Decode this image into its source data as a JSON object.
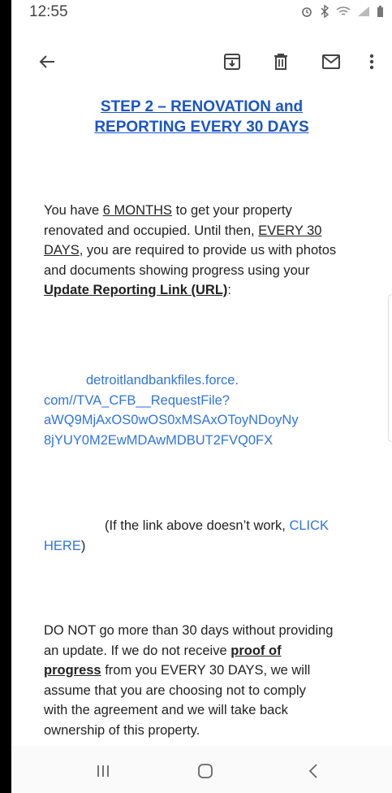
{
  "status_bar": {
    "time": "12:55"
  },
  "toolbar": {
    "back_icon": "arrow-left-icon",
    "archive_icon": "archive-icon",
    "delete_icon": "trash-icon",
    "mail_icon": "mail-icon",
    "more_icon": "more-vert-icon"
  },
  "email": {
    "heading_line1": "STEP 2 – RENOVATION and",
    "heading_line2": "REPORTING EVERY 30 DAYS",
    "p1": {
      "l1_a": "You have ",
      "l1_b": "6 MONTHS",
      "l1_c": " to get your property",
      "l2_a": "renovated and occupied. Until then, ",
      "l2_b": "EVERY 30",
      "l3_a": "DAYS",
      "l3_b": ", you are required to provide us with photos",
      "l4": "and documents showing progress using your",
      "l5_a": "Update Reporting Link (URL)",
      "l5_b": ":"
    },
    "link": {
      "l1": "detroitlandbankfiles.force.",
      "l2": "com//TVA_CFB__RequestFile?",
      "l3": "aWQ9MjAxOS0wOS0xMSAxOToyNDoyNy",
      "l4": "8jYUY0M2EwMDAwMDBUT2FVQ0FX"
    },
    "fallback": {
      "a": "(If the link above doesn’t work, ",
      "click": "CLICK",
      "here": "HERE",
      "close": ")"
    },
    "p2": {
      "l1": "DO NOT go more than 30 days without providing",
      "l2_a": "an update. If we do not receive ",
      "l2_b": "proof of",
      "l3_a": "progress",
      "l3_b": " from you EVERY 30 DAYS, we will",
      "l4": "assume that you are choosing not to comply",
      "l5": "with the agreement and we will take back",
      "l6": "ownership of this property."
    }
  },
  "nav_bar": {
    "recents_icon": "recents-icon",
    "home_icon": "home-icon",
    "back_icon": "back-chevron-icon"
  }
}
